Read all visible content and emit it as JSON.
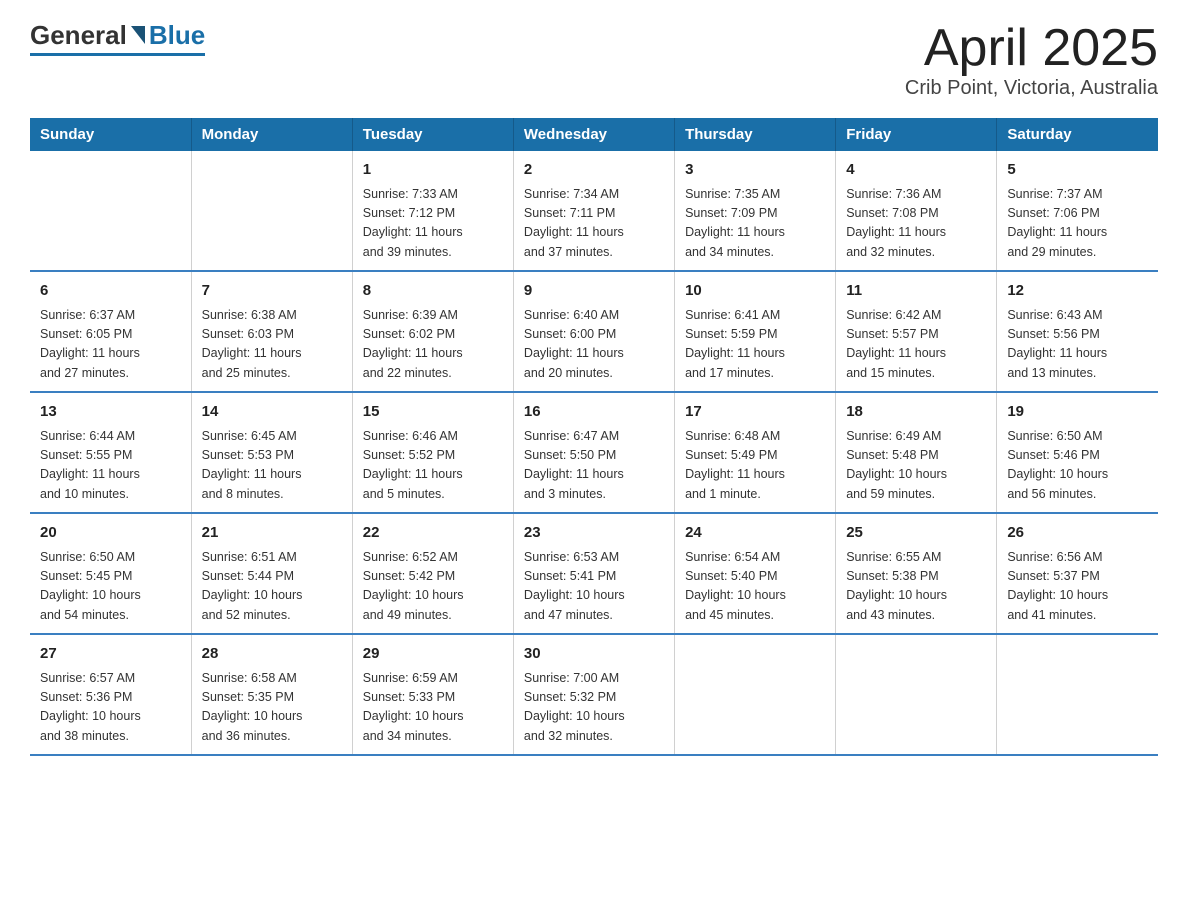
{
  "header": {
    "logo_general": "General",
    "logo_blue": "Blue",
    "title": "April 2025",
    "subtitle": "Crib Point, Victoria, Australia"
  },
  "calendar": {
    "days_of_week": [
      "Sunday",
      "Monday",
      "Tuesday",
      "Wednesday",
      "Thursday",
      "Friday",
      "Saturday"
    ],
    "weeks": [
      [
        {
          "day": "",
          "info": ""
        },
        {
          "day": "",
          "info": ""
        },
        {
          "day": "1",
          "info": "Sunrise: 7:33 AM\nSunset: 7:12 PM\nDaylight: 11 hours\nand 39 minutes."
        },
        {
          "day": "2",
          "info": "Sunrise: 7:34 AM\nSunset: 7:11 PM\nDaylight: 11 hours\nand 37 minutes."
        },
        {
          "day": "3",
          "info": "Sunrise: 7:35 AM\nSunset: 7:09 PM\nDaylight: 11 hours\nand 34 minutes."
        },
        {
          "day": "4",
          "info": "Sunrise: 7:36 AM\nSunset: 7:08 PM\nDaylight: 11 hours\nand 32 minutes."
        },
        {
          "day": "5",
          "info": "Sunrise: 7:37 AM\nSunset: 7:06 PM\nDaylight: 11 hours\nand 29 minutes."
        }
      ],
      [
        {
          "day": "6",
          "info": "Sunrise: 6:37 AM\nSunset: 6:05 PM\nDaylight: 11 hours\nand 27 minutes."
        },
        {
          "day": "7",
          "info": "Sunrise: 6:38 AM\nSunset: 6:03 PM\nDaylight: 11 hours\nand 25 minutes."
        },
        {
          "day": "8",
          "info": "Sunrise: 6:39 AM\nSunset: 6:02 PM\nDaylight: 11 hours\nand 22 minutes."
        },
        {
          "day": "9",
          "info": "Sunrise: 6:40 AM\nSunset: 6:00 PM\nDaylight: 11 hours\nand 20 minutes."
        },
        {
          "day": "10",
          "info": "Sunrise: 6:41 AM\nSunset: 5:59 PM\nDaylight: 11 hours\nand 17 minutes."
        },
        {
          "day": "11",
          "info": "Sunrise: 6:42 AM\nSunset: 5:57 PM\nDaylight: 11 hours\nand 15 minutes."
        },
        {
          "day": "12",
          "info": "Sunrise: 6:43 AM\nSunset: 5:56 PM\nDaylight: 11 hours\nand 13 minutes."
        }
      ],
      [
        {
          "day": "13",
          "info": "Sunrise: 6:44 AM\nSunset: 5:55 PM\nDaylight: 11 hours\nand 10 minutes."
        },
        {
          "day": "14",
          "info": "Sunrise: 6:45 AM\nSunset: 5:53 PM\nDaylight: 11 hours\nand 8 minutes."
        },
        {
          "day": "15",
          "info": "Sunrise: 6:46 AM\nSunset: 5:52 PM\nDaylight: 11 hours\nand 5 minutes."
        },
        {
          "day": "16",
          "info": "Sunrise: 6:47 AM\nSunset: 5:50 PM\nDaylight: 11 hours\nand 3 minutes."
        },
        {
          "day": "17",
          "info": "Sunrise: 6:48 AM\nSunset: 5:49 PM\nDaylight: 11 hours\nand 1 minute."
        },
        {
          "day": "18",
          "info": "Sunrise: 6:49 AM\nSunset: 5:48 PM\nDaylight: 10 hours\nand 59 minutes."
        },
        {
          "day": "19",
          "info": "Sunrise: 6:50 AM\nSunset: 5:46 PM\nDaylight: 10 hours\nand 56 minutes."
        }
      ],
      [
        {
          "day": "20",
          "info": "Sunrise: 6:50 AM\nSunset: 5:45 PM\nDaylight: 10 hours\nand 54 minutes."
        },
        {
          "day": "21",
          "info": "Sunrise: 6:51 AM\nSunset: 5:44 PM\nDaylight: 10 hours\nand 52 minutes."
        },
        {
          "day": "22",
          "info": "Sunrise: 6:52 AM\nSunset: 5:42 PM\nDaylight: 10 hours\nand 49 minutes."
        },
        {
          "day": "23",
          "info": "Sunrise: 6:53 AM\nSunset: 5:41 PM\nDaylight: 10 hours\nand 47 minutes."
        },
        {
          "day": "24",
          "info": "Sunrise: 6:54 AM\nSunset: 5:40 PM\nDaylight: 10 hours\nand 45 minutes."
        },
        {
          "day": "25",
          "info": "Sunrise: 6:55 AM\nSunset: 5:38 PM\nDaylight: 10 hours\nand 43 minutes."
        },
        {
          "day": "26",
          "info": "Sunrise: 6:56 AM\nSunset: 5:37 PM\nDaylight: 10 hours\nand 41 minutes."
        }
      ],
      [
        {
          "day": "27",
          "info": "Sunrise: 6:57 AM\nSunset: 5:36 PM\nDaylight: 10 hours\nand 38 minutes."
        },
        {
          "day": "28",
          "info": "Sunrise: 6:58 AM\nSunset: 5:35 PM\nDaylight: 10 hours\nand 36 minutes."
        },
        {
          "day": "29",
          "info": "Sunrise: 6:59 AM\nSunset: 5:33 PM\nDaylight: 10 hours\nand 34 minutes."
        },
        {
          "day": "30",
          "info": "Sunrise: 7:00 AM\nSunset: 5:32 PM\nDaylight: 10 hours\nand 32 minutes."
        },
        {
          "day": "",
          "info": ""
        },
        {
          "day": "",
          "info": ""
        },
        {
          "day": "",
          "info": ""
        }
      ]
    ]
  }
}
